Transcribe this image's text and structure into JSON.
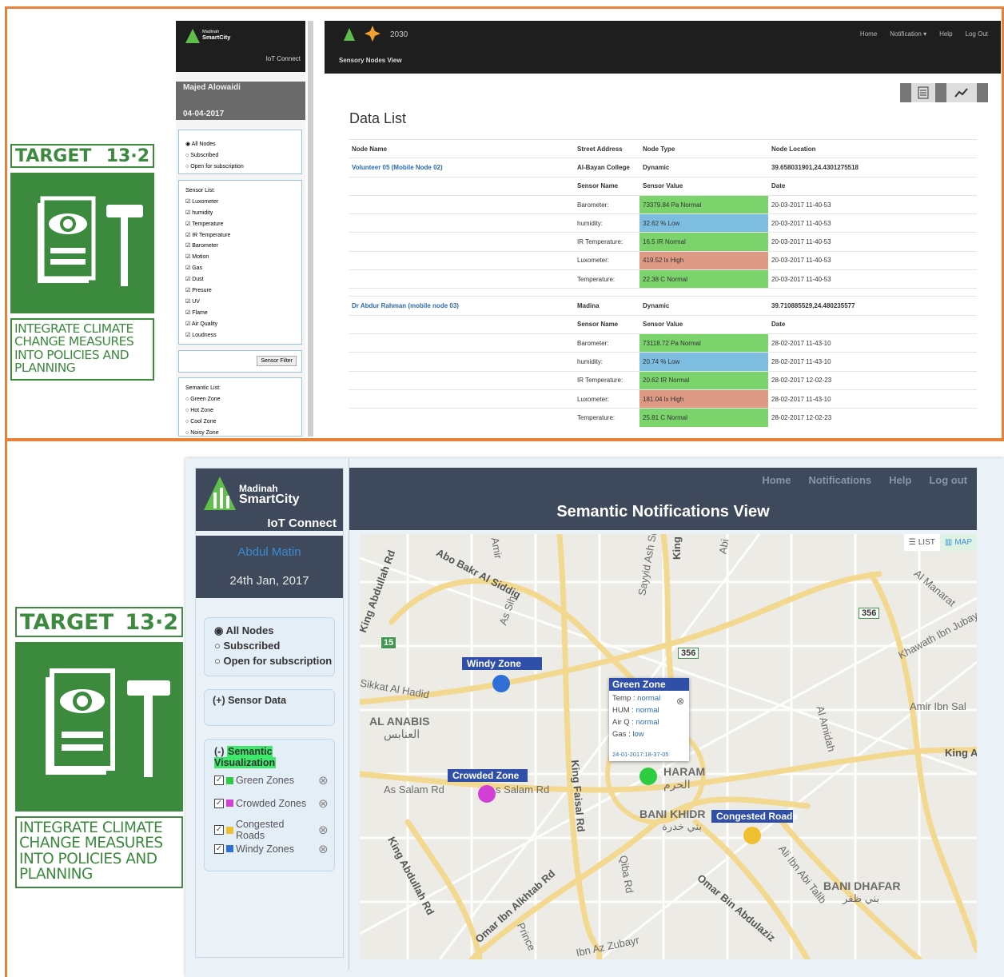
{
  "sdg": {
    "target_label": "TARGET",
    "target_number": "13·2",
    "caption": "INTEGRATE CLIMATE CHANGE MEASURES INTO POLICIES AND PLANNING"
  },
  "top": {
    "logo_line1": "Madinah",
    "logo_line2": "SmartCity",
    "iot_connect": "IoT Connect",
    "user_name": "Majed Alowaidi",
    "date": "04-04-2017",
    "page_subtitle": "Sensory Nodes View",
    "nav": [
      "Home",
      "Notification ▾",
      "Help",
      "Log Out"
    ],
    "node_filter": [
      "All Nodes",
      "Subscribed",
      "Open for subscription"
    ],
    "sensor_list_title": "Sensor List:",
    "sensors": [
      "Luxometer",
      "humidity",
      "Temperature",
      "IR Temperature",
      "Barometer",
      "Motion",
      "Gas",
      "Dust",
      "Presure",
      "UV",
      "Flame",
      "Air Quality",
      "Loudness"
    ],
    "sensor_filter_button": "Sensor Filter",
    "semantic_list_title": "Semantic List:",
    "semantic_list": [
      "Green Zone",
      "Hot Zone",
      "Cool Zone",
      "Noisy Zone"
    ],
    "data_list_title": "Data List",
    "columns": [
      "Node Name",
      "Street Address",
      "Node Type",
      "Node Location"
    ],
    "sub_columns": [
      "Sensor Name",
      "Sensor Value",
      "Date"
    ],
    "nodes": [
      {
        "name": "Volunteer 05 (Mobile Node 02)",
        "address": "Al-Bayan College",
        "type": "Dynamic",
        "location": "39.658031901,24.4301275518",
        "readings": [
          {
            "sensor": "Barometer:",
            "value": "73379.84 Pa Normal",
            "status": "green",
            "date": "20-03-2017 11-40-53"
          },
          {
            "sensor": "humidity:",
            "value": "32.62 % Low",
            "status": "blue",
            "date": "20-03-2017 11-40-53"
          },
          {
            "sensor": "IR Temperature:",
            "value": "16.5 IR Normal",
            "status": "green",
            "date": "20-03-2017 11-40-53"
          },
          {
            "sensor": "Luxometer:",
            "value": "419.52 lx High",
            "status": "red",
            "date": "20-03-2017 11-40-53"
          },
          {
            "sensor": "Temperature:",
            "value": "22.38 C Normal",
            "status": "green",
            "date": "20-03-2017 11-40-53"
          }
        ]
      },
      {
        "name": "Dr Abdur Rahman (mobile node 03)",
        "address": "Madina",
        "type": "Dynamic",
        "location": "39.710885529,24.480235577",
        "readings": [
          {
            "sensor": "Barometer:",
            "value": "73118.72 Pa Normal",
            "status": "green",
            "date": "28-02-2017 11-43-10"
          },
          {
            "sensor": "humidity:",
            "value": "20.74 % Low",
            "status": "blue",
            "date": "28-02-2017 11-43-10"
          },
          {
            "sensor": "IR Temperature:",
            "value": "20.62 IR Normal",
            "status": "green",
            "date": "28-02-2017 12-02-23"
          },
          {
            "sensor": "Luxometer:",
            "value": "181.04 lx High",
            "status": "red",
            "date": "28-02-2017 11-43-10"
          },
          {
            "sensor": "Temperature:",
            "value": "25.81 C Normal",
            "status": "green",
            "date": "28-02-2017 12-02-23"
          }
        ]
      }
    ]
  },
  "bottom": {
    "logo_line1": "Madinah",
    "logo_line2": "SmartCity",
    "iot_connect": "IoT Connect",
    "user_name": "Abdul Matin",
    "date": "24th Jan, 2017",
    "nav": [
      "Home",
      "Notifications",
      "Help",
      "Log out"
    ],
    "page_title": "Semantic Notifications View",
    "node_filter": [
      "All Nodes",
      "Subscribed",
      "Open for subscription"
    ],
    "sensor_data": "(+) Sensor Data",
    "semantic_prefix": "(-)",
    "semantic_visualization": "Semantic Visualization",
    "zones": [
      {
        "label": "Green Zones",
        "color": "#2ecc40"
      },
      {
        "label": "Crowded Zones",
        "color": "#d23fd6"
      },
      {
        "label": "Congested Roads",
        "color": "#f0c030"
      },
      {
        "label": "Windy Zones",
        "color": "#2f6fd6"
      }
    ],
    "view_toggle": {
      "list": "LIST",
      "map": "MAP"
    },
    "map_labels": {
      "abo_bakr": "Abo Bakr Al Siddiq",
      "king_abdullah": "King Abdullah Rd",
      "amir": "Amir",
      "as_sih": "As Sih",
      "sayyid": "Sayyid Ash Sh",
      "king_top": "King",
      "abi": "Abi",
      "al_manarat": "Al Manarat",
      "khawath": "Khawath Ibn Jubayr",
      "amir_ibn_sal": "Amir Ibn Sal",
      "king_a": "King A",
      "sikkat": "Sikkat Al Hadid",
      "al_anabis": "AL ANABIS",
      "al_anabis_ar": "العنابس",
      "as_salam": "As Salam Rd",
      "as_salam_2": "s Salam Rd",
      "king_faisal": "King Faisal Rd",
      "haram": "HARAM",
      "haram_ar": "الحرم",
      "bani_khidr": "BANI KHIDR",
      "bani_khidr_ar": "بني خدرة",
      "al_amidah": "Al Amidah",
      "bani_dhafar": "BANI DHAFAR",
      "bani_dhafar_ar": "بني ظفر",
      "qiba": "Qiba Rd",
      "omar_alkhtab": "Omar Ibn Alkhtab Rd",
      "omar_abdulaziz": "Omar Bin Abdulaziz",
      "ali_ibn": "Ali Ibn Abi Talib",
      "king_abdullah_2": "King Abdullah Rd",
      "prince": "Prince",
      "ibn_az": "Ibn Az Zubayr",
      "road_15": "15",
      "road_356a": "356",
      "road_356b": "356"
    },
    "pins": {
      "windy": "Windy Zone",
      "crowded": "Crowded Zone",
      "green": "Green Zone",
      "congested": "Congested Roads"
    },
    "popup": {
      "title": "Green Zone",
      "rows": [
        {
          "key": "Temp",
          "value": "normal"
        },
        {
          "key": "HUM",
          "value": "normal"
        },
        {
          "key": "Air Q",
          "value": "normal"
        },
        {
          "key": "Gas",
          "value": "low"
        }
      ],
      "timestamp": "24-01-2017:18-37-05"
    }
  }
}
